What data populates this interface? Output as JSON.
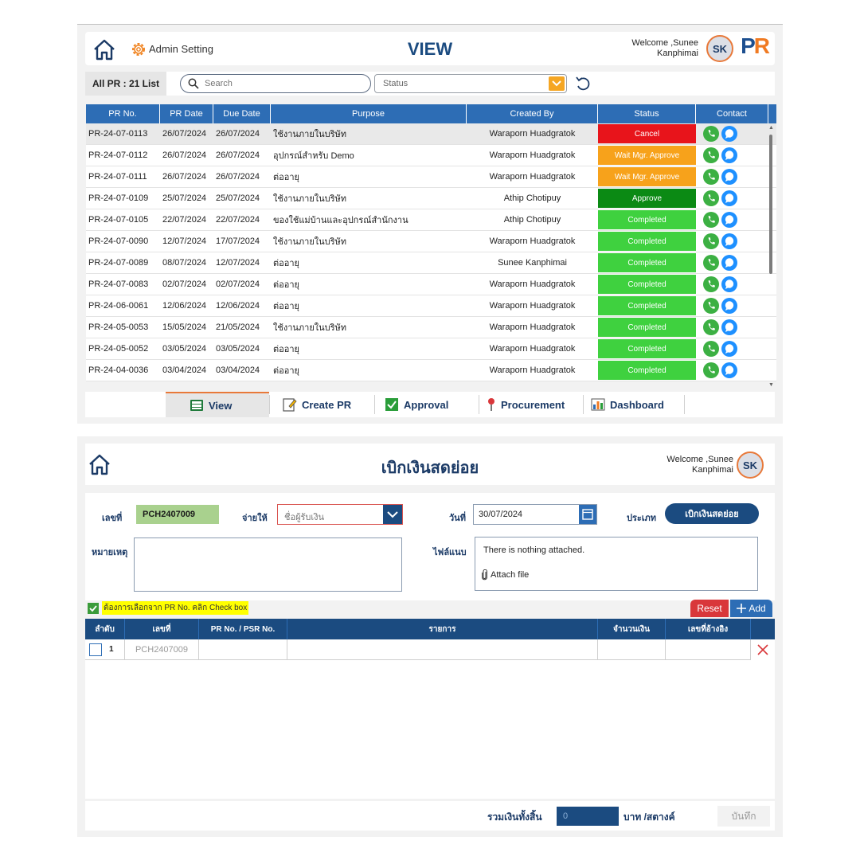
{
  "view_screen": {
    "header": {
      "admin_label": "Admin Setting",
      "title": "VIEW",
      "welcome_line1": "Welcome ,Sunee",
      "welcome_line2": "Kanphimai",
      "avatar": "SK",
      "logo_p": "P",
      "logo_r": "R"
    },
    "filter": {
      "count_label": "All PR : 21 List",
      "search_placeholder": "Search",
      "status_placeholder": "Status"
    },
    "table": {
      "columns": [
        "PR No.",
        "PR Date",
        "Due Date",
        "Purpose",
        "Created By",
        "Status",
        "Contact"
      ],
      "rows": [
        {
          "pr_no": "PR-24-07-0113",
          "pr_date": "26/07/2024",
          "due_date": "26/07/2024",
          "purpose": "ใช้งานภายในบริษัท",
          "created_by": "Waraporn Huadgratok",
          "status": "Cancel"
        },
        {
          "pr_no": "PR-24-07-0112",
          "pr_date": "26/07/2024",
          "due_date": "26/07/2024",
          "purpose": "อุปกรณ์สำหรับ Demo",
          "created_by": "Waraporn Huadgratok",
          "status": "Wait Mgr. Approve"
        },
        {
          "pr_no": "PR-24-07-0111",
          "pr_date": "26/07/2024",
          "due_date": "26/07/2024",
          "purpose": "ต่ออายุ",
          "created_by": "Waraporn Huadgratok",
          "status": "Wait Mgr. Approve"
        },
        {
          "pr_no": "PR-24-07-0109",
          "pr_date": "25/07/2024",
          "due_date": "25/07/2024",
          "purpose": "ใช้งานภายในบริษัท",
          "created_by": "Athip Chotipuy",
          "status": "Approve"
        },
        {
          "pr_no": "PR-24-07-0105",
          "pr_date": "22/07/2024",
          "due_date": "22/07/2024",
          "purpose": "ของใช้แม่บ้านและอุปกรณ์สำนักงาน",
          "created_by": "Athip Chotipuy",
          "status": "Completed"
        },
        {
          "pr_no": "PR-24-07-0090",
          "pr_date": "12/07/2024",
          "due_date": "17/07/2024",
          "purpose": "ใช้งานภายในบริษัท",
          "created_by": "Waraporn Huadgratok",
          "status": "Completed"
        },
        {
          "pr_no": "PR-24-07-0089",
          "pr_date": "08/07/2024",
          "due_date": "12/07/2024",
          "purpose": "ต่ออายุ",
          "created_by": "Sunee Kanphimai",
          "status": "Completed"
        },
        {
          "pr_no": "PR-24-07-0083",
          "pr_date": "02/07/2024",
          "due_date": "02/07/2024",
          "purpose": "ต่ออายุ",
          "created_by": "Waraporn Huadgratok",
          "status": "Completed"
        },
        {
          "pr_no": "PR-24-06-0061",
          "pr_date": "12/06/2024",
          "due_date": "12/06/2024",
          "purpose": "ต่ออายุ",
          "created_by": "Waraporn Huadgratok",
          "status": "Completed"
        },
        {
          "pr_no": "PR-24-05-0053",
          "pr_date": "15/05/2024",
          "due_date": "21/05/2024",
          "purpose": "ใช้งานภายในบริษัท",
          "created_by": "Waraporn Huadgratok",
          "status": "Completed"
        },
        {
          "pr_no": "PR-24-05-0052",
          "pr_date": "03/05/2024",
          "due_date": "03/05/2024",
          "purpose": "ต่ออายุ",
          "created_by": "Waraporn Huadgratok",
          "status": "Completed"
        },
        {
          "pr_no": "PR-24-04-0036",
          "pr_date": "03/04/2024",
          "due_date": "03/04/2024",
          "purpose": "ต่ออายุ",
          "created_by": "Waraporn Huadgratok",
          "status": "Completed"
        }
      ]
    },
    "status_colors": {
      "Cancel": "#e8141b",
      "Wait Mgr. Approve": "#f7a21b",
      "Approve": "#0b8a14",
      "Completed": "#3fd13f"
    },
    "nav": {
      "view": "View",
      "create_pr": "Create PR",
      "approval": "Approval",
      "procurement": "Procurement",
      "dashboard": "Dashboard"
    }
  },
  "petty_screen": {
    "header": {
      "title": "เบิกเงินสดย่อย",
      "welcome_line1": "Welcome ,Sunee",
      "welcome_line2": "Kanphimai",
      "avatar": "SK"
    },
    "form": {
      "doc_no_label": "เลขที่",
      "doc_no_value": "PCH2407009",
      "payee_label": "จ่ายให้",
      "payee_placeholder": "ชื่อผู้รับเงิน",
      "date_label": "วันที่",
      "date_value": "30/07/2024",
      "type_label": "ประเภท",
      "type_value": "เบิกเงินสดย่อย",
      "remark_label": "หมายเหตุ",
      "attach_label": "ไฟล์แนบ",
      "attach_empty": "There is nothing attached.",
      "attach_button": "Attach file"
    },
    "checkbox_option": "ต้องการเลือกจาก PR No. คลิก Check box",
    "reset_label": "Reset",
    "add_label": "Add",
    "table": {
      "columns": [
        "ลำดับ",
        "เลขที่",
        "PR No. / PSR No.",
        "รายการ",
        "จำนวนเงิน",
        "เลขที่อ้างอิง"
      ],
      "rows": [
        {
          "seq": "1",
          "doc_no": "PCH2407009",
          "pr_no": "",
          "item": "",
          "amount": "",
          "ref": ""
        }
      ]
    },
    "footer": {
      "total_label": "รวมเงินทั้งสิ้น",
      "total_value": "0",
      "unit_label": "บาท /สตางค์",
      "save_label": "บันทึก"
    }
  }
}
